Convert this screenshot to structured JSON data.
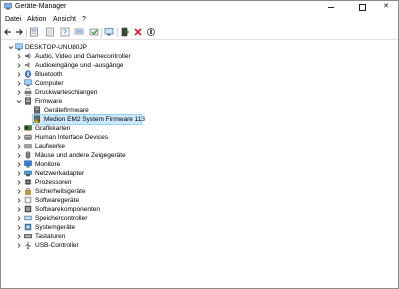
{
  "window": {
    "title": "Geräte-Manager",
    "controls": {
      "minimize": "",
      "maximize": "",
      "close": "✕"
    }
  },
  "menu": [
    "Datei",
    "Aktion",
    "Ansicht",
    "?"
  ],
  "toolbar": {
    "buttons": [
      "back-icon",
      "forward-icon",
      "properties-icon",
      "help-icon",
      "update-driver-icon",
      "show-hidden-icon",
      "computer-icon",
      "add-legacy-icon",
      "remove-icon",
      "scan-icon"
    ]
  },
  "tree": {
    "root": "DESKTOP-UNU80JP",
    "items": [
      {
        "label": "Audio, Video und Gamecontroller",
        "icon": "speaker-icon",
        "expanded": false
      },
      {
        "label": "Audioeingänge und -ausgänge",
        "icon": "audio-io-icon",
        "expanded": false
      },
      {
        "label": "Bluetooth",
        "icon": "bluetooth-icon",
        "expanded": false
      },
      {
        "label": "Computer",
        "icon": "computer-icon",
        "expanded": false
      },
      {
        "label": "Druckwarteschlangen",
        "icon": "printer-icon",
        "expanded": false
      },
      {
        "label": "Firmware",
        "icon": "firmware-icon",
        "expanded": true
      },
      {
        "label": "Gerätefirmware",
        "icon": "firmware-device-icon",
        "child": true
      },
      {
        "label": "Medion EM2 System Firmware 113",
        "icon": "warning-firmware-icon",
        "child": true,
        "selected": true
      },
      {
        "label": "Grafikkarten",
        "icon": "display-adapter-icon",
        "expanded": false
      },
      {
        "label": "Human Interface Devices",
        "icon": "hid-icon",
        "expanded": false
      },
      {
        "label": "Laufwerke",
        "icon": "drive-icon",
        "expanded": false
      },
      {
        "label": "Mäuse und andere Zeigegeräte",
        "icon": "mouse-icon",
        "expanded": false
      },
      {
        "label": "Monitore",
        "icon": "monitor-icon",
        "expanded": false
      },
      {
        "label": "Netzwerkadapter",
        "icon": "network-icon",
        "expanded": false
      },
      {
        "label": "Prozessoren",
        "icon": "processor-icon",
        "expanded": false
      },
      {
        "label": "Sicherheitsgeräte",
        "icon": "security-icon",
        "expanded": false
      },
      {
        "label": "Softwaregeräte",
        "icon": "software-device-icon",
        "expanded": false
      },
      {
        "label": "Softwarekomponenten",
        "icon": "software-component-icon",
        "expanded": false
      },
      {
        "label": "Speichercontroller",
        "icon": "storage-controller-icon",
        "expanded": false
      },
      {
        "label": "Systemgeräte",
        "icon": "system-device-icon",
        "expanded": false
      },
      {
        "label": "Tastaturen",
        "icon": "keyboard-icon",
        "expanded": false
      },
      {
        "label": "USB-Controller",
        "icon": "usb-icon",
        "expanded": false
      }
    ]
  },
  "colors": {
    "selection": "#cce8ff",
    "selection_border": "#99d1ff",
    "warning": "#f5c400",
    "error": "#d42020"
  }
}
